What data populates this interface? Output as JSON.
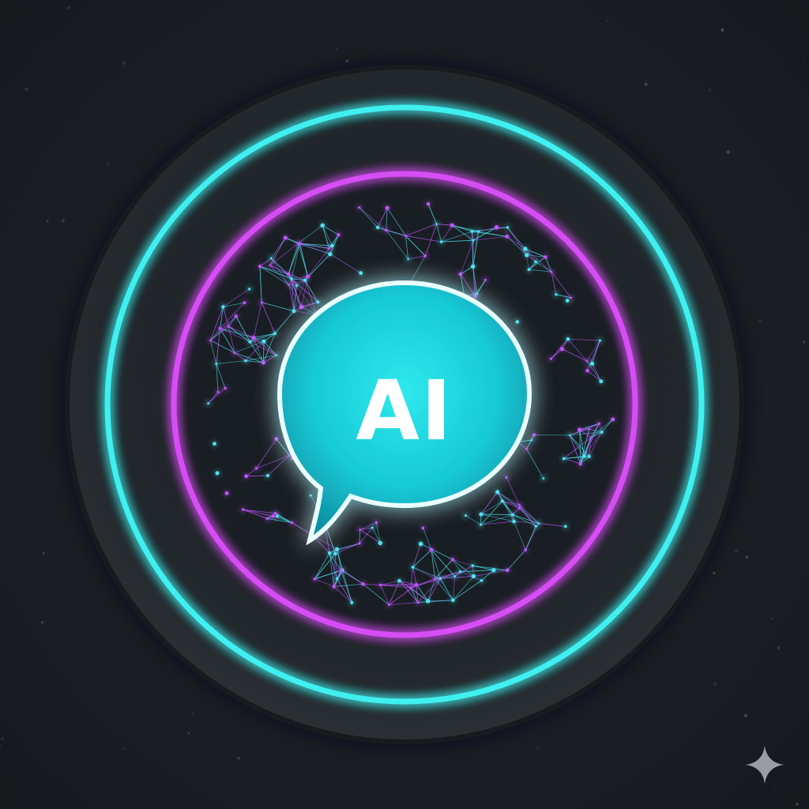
{
  "logo": {
    "text": "AI",
    "icon": "chat-bubble-icon"
  },
  "colors": {
    "background": "#1c2025",
    "disc": "#23272b",
    "outer_ring": "#40f0f0",
    "inner_ring": "#d74ef5",
    "bubble_fill": "#1fd6e0",
    "bubble_stroke": "#e9ffff",
    "network_cyan": "#4fe3f0",
    "network_magenta": "#c056ff",
    "logo_text": "#ffffff",
    "corner_star": "#9a9ea3"
  },
  "corner_mark": {
    "icon": "sparkle-icon"
  }
}
